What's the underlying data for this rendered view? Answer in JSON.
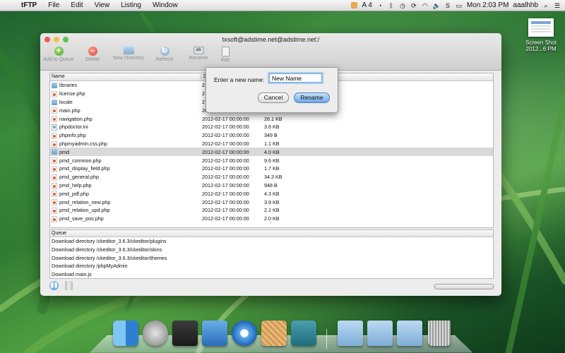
{
  "menubar": {
    "app": "tFTP",
    "items": [
      "File",
      "Edit",
      "View",
      "Listing",
      "Window"
    ],
    "tray_text": "A 4",
    "clock": "Mon 2:03 PM",
    "user": "aaalhhb"
  },
  "desktop_icon": {
    "line1": "Screen Shot",
    "line2": "2012...6 PM"
  },
  "window": {
    "title": "txsoft@adstime.net@adstime.net:/",
    "toolbar": {
      "add": "Add to Queue",
      "delete": "Delete",
      "new_dir": "New Directory",
      "refresh": "Refresh",
      "rename": "Rename",
      "edit": "Edit"
    },
    "columns": {
      "name": "Name",
      "date": "D"
    },
    "files": [
      {
        "name": "libraries",
        "date": "2",
        "size": "",
        "type": "folder"
      },
      {
        "name": "license.php",
        "date": "2",
        "size": "",
        "type": "php"
      },
      {
        "name": "locale",
        "date": "2",
        "size": "",
        "type": "folder"
      },
      {
        "name": "main.php",
        "date": "2012-02-17 00:00:00",
        "size": "15.6 KB",
        "type": "php"
      },
      {
        "name": "navigation.php",
        "date": "2012-02-17 00:00:00",
        "size": "26.1 KB",
        "type": "php"
      },
      {
        "name": "phpdoctor.ini",
        "date": "2012-02-17 00:00:00",
        "size": "3.6 KB",
        "type": "ini"
      },
      {
        "name": "phpinfo.php",
        "date": "2012-02-17 00:00:00",
        "size": "349 B",
        "type": "php"
      },
      {
        "name": "phpmyadmin.css.php",
        "date": "2012-02-17 00:00:00",
        "size": "1.1 KB",
        "type": "php"
      },
      {
        "name": "pmd",
        "date": "2012-02-17 00:00:00",
        "size": "4.0 KB",
        "type": "folder",
        "selected": true
      },
      {
        "name": "pmd_common.php",
        "date": "2012-02-17 00:00:00",
        "size": "9.6 KB",
        "type": "php"
      },
      {
        "name": "pmd_display_field.php",
        "date": "2012-02-17 00:00:00",
        "size": "1.7 KB",
        "type": "php"
      },
      {
        "name": "pmd_general.php",
        "date": "2012-02-17 00:00:00",
        "size": "34.3 KB",
        "type": "php"
      },
      {
        "name": "pmd_help.php",
        "date": "2012-02-17 00:00:00",
        "size": "948 B",
        "type": "php"
      },
      {
        "name": "pmd_pdf.php",
        "date": "2012-02-17 00:00:00",
        "size": "4.3 KB",
        "type": "php"
      },
      {
        "name": "pmd_relation_new.php",
        "date": "2012-02-17 00:00:00",
        "size": "3.9 KB",
        "type": "php"
      },
      {
        "name": "pmd_relation_upd.php",
        "date": "2012-02-17 00:00:00",
        "size": "2.1 KB",
        "type": "php"
      },
      {
        "name": "pmd_save_pos.php",
        "date": "2012-02-17 00:00:00",
        "size": "2.0 KB",
        "type": "php"
      }
    ],
    "queue": {
      "header": "Queue",
      "items": [
        "Download directory /ckeditor_3.6.3/ckeditor/plugins",
        "Download directory /ckeditor_3.6.3/ckeditor/skins",
        "Download directory /ckeditor_3.6.3/ckeditor/themes",
        "Download directory /phpMyAdmin",
        "Download main.js"
      ]
    }
  },
  "rename_sheet": {
    "label": "Enter a new name:",
    "value": "New Name",
    "cancel": "Cancel",
    "rename": "Rename"
  }
}
